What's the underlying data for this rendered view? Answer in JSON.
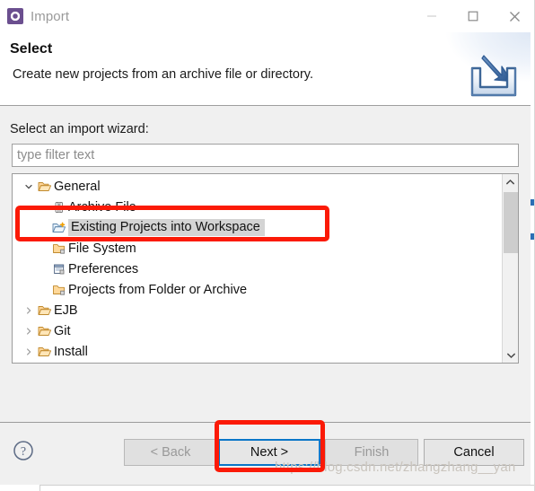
{
  "window": {
    "title": "Import",
    "icon": "eclipse-gear-icon",
    "controls": {
      "minimize": "minimize-icon",
      "maximize": "maximize-icon",
      "close": "close-icon"
    }
  },
  "header": {
    "title": "Select",
    "description": "Create new projects from an archive file or directory.",
    "banner_icon": "import-arrow-into-tray-icon"
  },
  "body": {
    "field_label": "Select an import wizard:",
    "filter": {
      "value": "",
      "placeholder": "type filter text"
    },
    "tree": [
      {
        "label": "General",
        "level": 0,
        "expanded": true,
        "icon": "open-folder-icon",
        "selected": false
      },
      {
        "label": "Archive File",
        "level": 1,
        "expanded": null,
        "icon": "archive-file-icon",
        "selected": false
      },
      {
        "label": "Existing Projects into Workspace",
        "level": 1,
        "expanded": null,
        "icon": "folder-plus-icon",
        "selected": true
      },
      {
        "label": "File System",
        "level": 1,
        "expanded": null,
        "icon": "folder-icon",
        "selected": false
      },
      {
        "label": "Preferences",
        "level": 1,
        "expanded": null,
        "icon": "preferences-icon",
        "selected": false
      },
      {
        "label": "Projects from Folder or Archive",
        "level": 1,
        "expanded": null,
        "icon": "folder-icon",
        "selected": false
      },
      {
        "label": "EJB",
        "level": 0,
        "expanded": false,
        "icon": "open-folder-icon",
        "selected": false
      },
      {
        "label": "Git",
        "level": 0,
        "expanded": false,
        "icon": "open-folder-icon",
        "selected": false
      },
      {
        "label": "Install",
        "level": 0,
        "expanded": false,
        "icon": "open-folder-icon",
        "selected": false
      }
    ],
    "scrollbar": {
      "up_arrow": "chevron-up-icon",
      "down_arrow": "chevron-down-icon"
    }
  },
  "footer": {
    "help_icon": "help-question-icon",
    "buttons": [
      {
        "id": "back",
        "label": "< Back",
        "enabled": false,
        "focused": false
      },
      {
        "id": "next",
        "label": "Next >",
        "enabled": true,
        "focused": true
      },
      {
        "id": "finish",
        "label": "Finish",
        "enabled": false,
        "focused": false
      },
      {
        "id": "cancel",
        "label": "Cancel",
        "enabled": true,
        "focused": false
      }
    ]
  },
  "annotations": {
    "color": "#fb1a07",
    "tree_highlight_target": "Existing Projects into Workspace",
    "button_highlight_target": "Next >"
  },
  "watermark": "https://blog.csdn.net/zhangzhang__yan"
}
